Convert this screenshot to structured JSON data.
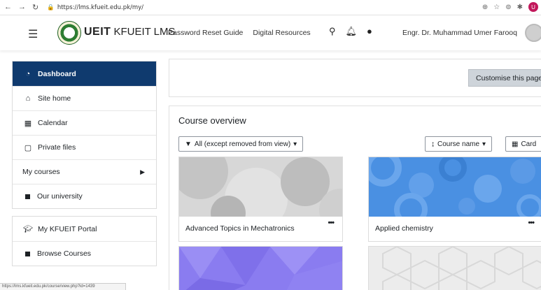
{
  "browser": {
    "url": "https://lms.kfueit.edu.pk/my/",
    "status_url": "https://lms.kfueit.edu.pk/course/view.php?id=1439"
  },
  "navbar": {
    "brand_bold": "UEIT",
    "brand_rest": "KFUEIT LMS",
    "menu": [
      "Password Reset Guide",
      "Digital Resources"
    ],
    "user_name": "Engr. Dr. Muhammad Umer Farooq"
  },
  "sidebar": {
    "group1": [
      {
        "label": "Dashboard",
        "icon": "tachometer-icon"
      },
      {
        "label": "Site home",
        "icon": "home-icon"
      },
      {
        "label": "Calendar",
        "icon": "calendar-icon"
      },
      {
        "label": "Private files",
        "icon": "file-icon"
      },
      {
        "label": "My courses",
        "icon": ""
      },
      {
        "label": "Our university",
        "icon": "square-bullet"
      }
    ],
    "group2": [
      {
        "label": "My KFUEIT Portal",
        "icon": "graduation-cap-icon"
      },
      {
        "label": "Browse Courses",
        "icon": "square-bullet"
      }
    ]
  },
  "main": {
    "customise_label": "Customise this page",
    "overview_title": "Course overview",
    "filter_label": "All (except removed from view)",
    "sort_label": "Course name",
    "view_label": "Card",
    "courses": [
      {
        "name": "Advanced Topics in Mechatronics"
      },
      {
        "name": "Applied chemistry"
      },
      {
        "name": ""
      },
      {
        "name": ""
      }
    ]
  },
  "colors": {
    "active_nav": "#0f3a6e",
    "card2_bg": "#4a90e2",
    "card3_bg": "#8a7cf0"
  }
}
